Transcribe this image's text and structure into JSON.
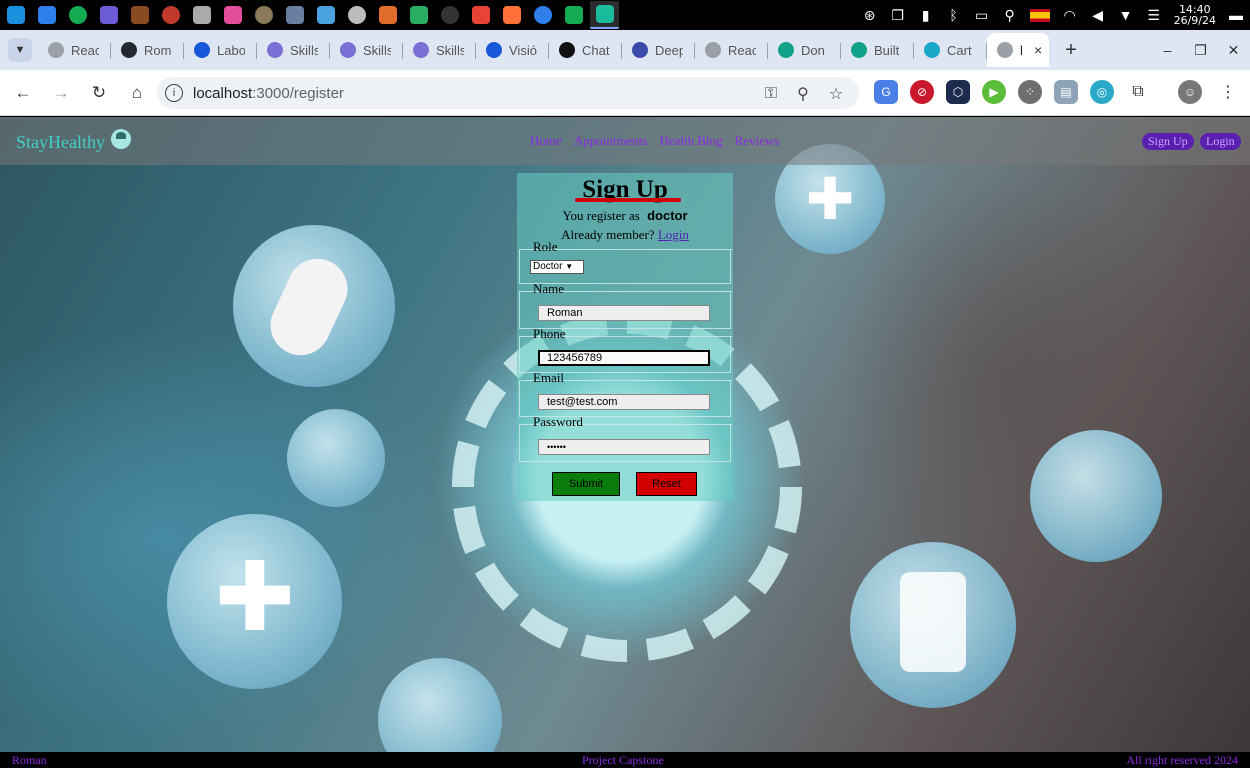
{
  "os": {
    "clock_time": "14:40",
    "clock_date": "26/9/24",
    "apps": [
      {
        "name": "app-1",
        "color": "#1b8fe0"
      },
      {
        "name": "vscode",
        "color": "#2f80ed"
      },
      {
        "name": "mongodb",
        "color": "#13aa52"
      },
      {
        "name": "app-4",
        "color": "#6b5bd6"
      },
      {
        "name": "app-5",
        "color": "#8b4b20"
      },
      {
        "name": "app-6",
        "color": "#c0392b"
      },
      {
        "name": "app-7",
        "color": "#aaaaaa"
      },
      {
        "name": "app-8",
        "color": "#e44d9a"
      },
      {
        "name": "gimp",
        "color": "#8b7a5a"
      },
      {
        "name": "app-10",
        "color": "#6a7fa0"
      },
      {
        "name": "app-11",
        "color": "#4aa3df"
      },
      {
        "name": "files",
        "color": "#bdbdbd"
      },
      {
        "name": "app-13",
        "color": "#e06c2a"
      },
      {
        "name": "app-14",
        "color": "#27ae60"
      },
      {
        "name": "terminal",
        "color": "#333333"
      },
      {
        "name": "chrome",
        "color": "#ea4335"
      },
      {
        "name": "firefox",
        "color": "#ff7139"
      },
      {
        "name": "vscode-2",
        "color": "#2f80ed"
      },
      {
        "name": "mongodb-2",
        "color": "#13aa52"
      },
      {
        "name": "app-20",
        "color": "#1abc9c"
      }
    ]
  },
  "browser": {
    "tabs": [
      {
        "label": "Reac",
        "favicon_color": "#9aa0a6"
      },
      {
        "label": "Rom",
        "favicon_color": "#24292f"
      },
      {
        "label": "Labo",
        "favicon_color": "#1a56db"
      },
      {
        "label": "Skills",
        "favicon_color": "#7b6fd6"
      },
      {
        "label": "Skills",
        "favicon_color": "#7b6fd6"
      },
      {
        "label": "Skills",
        "favicon_color": "#7b6fd6"
      },
      {
        "label": "Visió",
        "favicon_color": "#1a56db"
      },
      {
        "label": "Chat",
        "favicon_color": "#111111"
      },
      {
        "label": "Deep",
        "favicon_color": "#3a4aa8"
      },
      {
        "label": "Reac",
        "favicon_color": "#9aa0a6"
      },
      {
        "label": "Don",
        "favicon_color": "#12a189"
      },
      {
        "label": "Built",
        "favicon_color": "#12a189"
      },
      {
        "label": "Cart",
        "favicon_color": "#1aa7c8"
      }
    ],
    "active_tab": {
      "label": "l",
      "favicon_color": "#9aa0a6",
      "close": "×"
    },
    "new_tab": "+",
    "url_host": "localhost",
    "url_path": ":3000/register",
    "win_min": "–",
    "win_max": "❐",
    "win_close": "✕"
  },
  "site": {
    "brand": "StayHealthy",
    "menu": [
      "Home",
      "Appointments",
      "Health Blog",
      "Reviews"
    ],
    "signup_button": "Sign Up",
    "login_button": "Login",
    "form": {
      "title": "Sign Up",
      "register_as_prefix": "You register as",
      "register_as_role": "doctor",
      "already_member": "Already member?",
      "login_link": "Login",
      "role_label": "Role",
      "role_value": "Doctor",
      "name_label": "Name",
      "name_value": "Roman",
      "phone_label": "Phone",
      "phone_value": "123456789",
      "email_label": "Email",
      "email_value": "test@test.com",
      "password_label": "Password",
      "password_value": "••••••",
      "submit_label": "Submit",
      "reset_label": "Reset",
      "submit_color": "#0a7d0a",
      "reset_color": "#d40000"
    },
    "footer": {
      "left": "Roman",
      "center": "Project Capstone",
      "right": "All right reserved 2024"
    }
  }
}
